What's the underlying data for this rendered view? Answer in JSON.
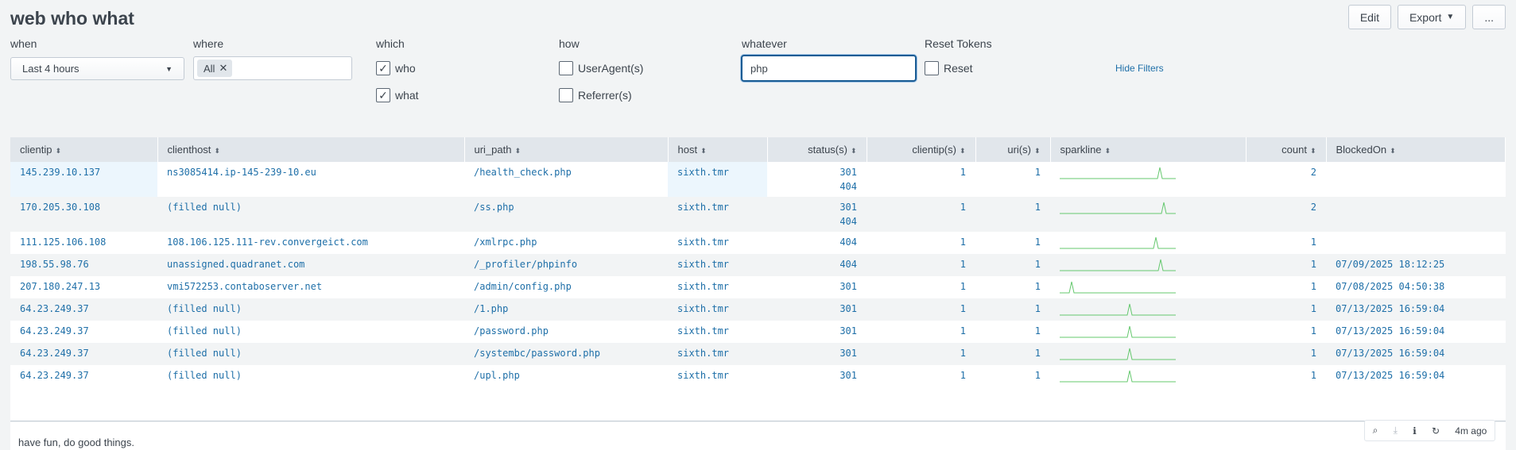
{
  "dashboard": {
    "title": "web who what"
  },
  "toolbar": {
    "edit": "Edit",
    "export": "Export",
    "more": "..."
  },
  "filters": {
    "when": {
      "label": "when",
      "value": "Last 4 hours"
    },
    "where": {
      "label": "where",
      "chip": "All"
    },
    "which": {
      "label": "which",
      "options": [
        {
          "label": "who",
          "checked": true
        },
        {
          "label": "what",
          "checked": true
        }
      ]
    },
    "how": {
      "label": "how",
      "options": [
        {
          "label": "UserAgent(s)",
          "checked": false
        },
        {
          "label": "Referrer(s)",
          "checked": false
        }
      ]
    },
    "whatever": {
      "label": "whatever",
      "value": "php"
    },
    "reset": {
      "label": "Reset Tokens",
      "option": "Reset"
    },
    "hide_filters": "Hide Filters"
  },
  "table": {
    "columns": [
      "clientip",
      "clienthost",
      "uri_path",
      "host",
      "status(s)",
      "clientip(s)",
      "uri(s)",
      "sparkline",
      "count",
      "BlockedOn"
    ],
    "rows": [
      {
        "clientip": "145.239.10.137",
        "clienthost": "ns3085414.ip-145-239-10.eu",
        "uri_path": "/health_check.php",
        "host": "sixth.tmr",
        "status": [
          "301",
          "404"
        ],
        "clientips": "1",
        "uris": "1",
        "spark_peak": 0.86,
        "count": "2",
        "blocked": ""
      },
      {
        "clientip": "170.205.30.108",
        "clienthost": "(filled null)",
        "uri_path": "/ss.php",
        "host": "sixth.tmr",
        "status": [
          "301",
          "404"
        ],
        "clientips": "1",
        "uris": "1",
        "spark_peak": 0.9,
        "count": "2",
        "blocked": ""
      },
      {
        "clientip": "111.125.106.108",
        "clienthost": "108.106.125.111-rev.convergeict.com",
        "uri_path": "/xmlrpc.php",
        "host": "sixth.tmr",
        "status": [
          "404"
        ],
        "clientips": "1",
        "uris": "1",
        "spark_peak": 0.83,
        "count": "1",
        "blocked": ""
      },
      {
        "clientip": "198.55.98.76",
        "clienthost": "unassigned.quadranet.com",
        "uri_path": "/_profiler/phpinfo",
        "host": "sixth.tmr",
        "status": [
          "404"
        ],
        "clientips": "1",
        "uris": "1",
        "spark_peak": 0.87,
        "count": "1",
        "blocked": "07/09/2025 18:12:25"
      },
      {
        "clientip": "207.180.247.13",
        "clienthost": "vmi572253.contaboserver.net",
        "uri_path": "/admin/config.php",
        "host": "sixth.tmr",
        "status": [
          "301"
        ],
        "clientips": "1",
        "uris": "1",
        "spark_peak": 0.1,
        "count": "1",
        "blocked": "07/08/2025 04:50:38"
      },
      {
        "clientip": "64.23.249.37",
        "clienthost": "(filled null)",
        "uri_path": "/1.php",
        "host": "sixth.tmr",
        "status": [
          "301"
        ],
        "clientips": "1",
        "uris": "1",
        "spark_peak": 0.6,
        "count": "1",
        "blocked": "07/13/2025 16:59:04"
      },
      {
        "clientip": "64.23.249.37",
        "clienthost": "(filled null)",
        "uri_path": "/password.php",
        "host": "sixth.tmr",
        "status": [
          "301"
        ],
        "clientips": "1",
        "uris": "1",
        "spark_peak": 0.6,
        "count": "1",
        "blocked": "07/13/2025 16:59:04"
      },
      {
        "clientip": "64.23.249.37",
        "clienthost": "(filled null)",
        "uri_path": "/systembc/password.php",
        "host": "sixth.tmr",
        "status": [
          "301"
        ],
        "clientips": "1",
        "uris": "1",
        "spark_peak": 0.6,
        "count": "1",
        "blocked": "07/13/2025 16:59:04"
      },
      {
        "clientip": "64.23.249.37",
        "clienthost": "(filled null)",
        "uri_path": "/upl.php",
        "host": "sixth.tmr",
        "status": [
          "301"
        ],
        "clientips": "1",
        "uris": "1",
        "spark_peak": 0.6,
        "count": "1",
        "blocked": "07/13/2025 16:59:04"
      }
    ]
  },
  "footer": {
    "text": "have fun, do good things.",
    "last_refresh": "4m ago"
  },
  "colors": {
    "link": "#1e6fa8",
    "sparkline": "#65c86e",
    "header_bg": "#e1e6eb",
    "focus": "#1a5c94"
  }
}
